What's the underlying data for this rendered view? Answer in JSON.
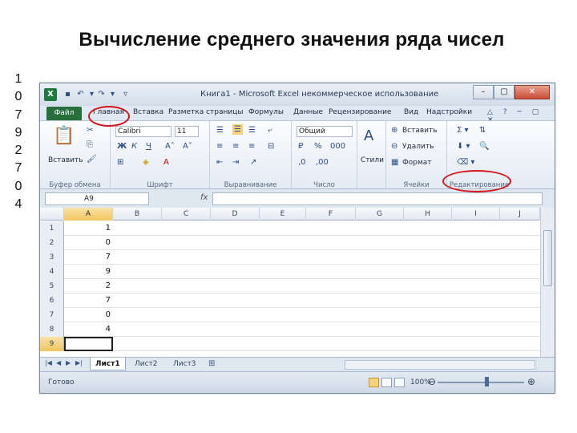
{
  "slide": {
    "title": "Вычисление среднего значения ряда чисел",
    "side_digits": [
      "1",
      "0",
      "7",
      "9",
      "2",
      "7",
      "0",
      "4"
    ]
  },
  "excel": {
    "window_title": "Книга1 - Microsoft Excel некоммерческое использование",
    "tabs": {
      "file": "Файл",
      "home": "Главная",
      "insert": "Вставка",
      "page_layout": "Разметка страницы",
      "formulas": "Формулы",
      "data": "Данные",
      "review": "Рецензирование",
      "view": "Вид",
      "addins": "Надстройки"
    },
    "ribbon": {
      "clipboard": {
        "paste": "Вставить",
        "label": "Буфер обмена"
      },
      "font": {
        "name": "Calibri",
        "size": "11",
        "label": "Шрифт"
      },
      "alignment": {
        "label": "Выравнивание"
      },
      "number": {
        "format": "Общий",
        "label": "Число"
      },
      "styles": {
        "button": "Стили"
      },
      "cells": {
        "insert": "Вставить",
        "delete": "Удалить",
        "format": "Формат",
        "label": "Ячейки"
      },
      "editing": {
        "label": "Редактирование"
      }
    },
    "formula_bar": {
      "name_box": "A9",
      "fx": "fx",
      "formula": ""
    },
    "columns": [
      "A",
      "B",
      "C",
      "D",
      "E",
      "F",
      "G",
      "H",
      "I",
      "J"
    ],
    "selected_column": "A",
    "rows": [
      {
        "n": "1",
        "a": "1"
      },
      {
        "n": "2",
        "a": "0"
      },
      {
        "n": "3",
        "a": "7"
      },
      {
        "n": "4",
        "a": "9"
      },
      {
        "n": "5",
        "a": "2"
      },
      {
        "n": "6",
        "a": "7"
      },
      {
        "n": "7",
        "a": "0"
      },
      {
        "n": "8",
        "a": "4"
      },
      {
        "n": "9",
        "a": ""
      }
    ],
    "active_row": "9",
    "sheet_tabs": [
      "Лист1",
      "Лист2",
      "Лист3"
    ],
    "active_sheet": "Лист1",
    "status": {
      "ready": "Готово",
      "zoom": "100%"
    },
    "highlights": [
      "tab-home",
      "editing-group"
    ],
    "colors": {
      "highlight": "#d0161b",
      "file_tab": "#2b6e3e",
      "selection": "#f1c65d"
    }
  }
}
